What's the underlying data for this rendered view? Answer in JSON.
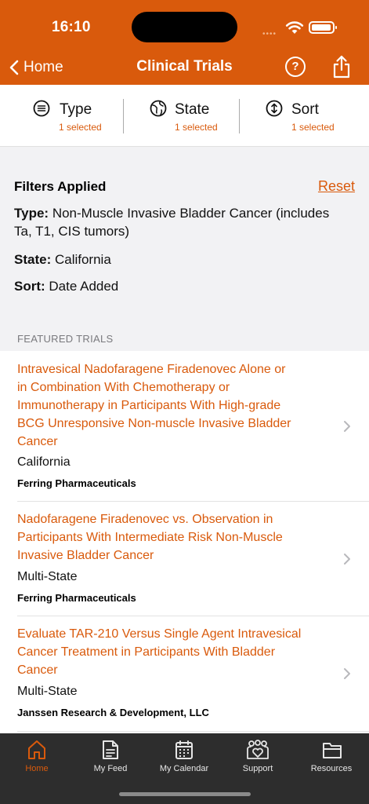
{
  "status_bar": {
    "time": "16:10"
  },
  "nav": {
    "back_label": "Home",
    "title": "Clinical Trials"
  },
  "filters": [
    {
      "label": "Type",
      "sub": "1 selected",
      "icon": "list-icon"
    },
    {
      "label": "State",
      "sub": "1 selected",
      "icon": "globe-icon"
    },
    {
      "label": "Sort",
      "sub": "1 selected",
      "icon": "sort-icon"
    }
  ],
  "applied": {
    "heading": "Filters Applied",
    "reset": "Reset",
    "type_key": "Type:",
    "type_line1": "Non-Muscle Invasive Bladder Cancer (includes",
    "type_line2": "Ta, T1, CIS tumors)",
    "state_key": "State:",
    "state_val": "California",
    "sort_key": "Sort:",
    "sort_val": "Date Added"
  },
  "section": {
    "featured": "FEATURED TRIALS"
  },
  "trials": [
    {
      "title_lines": [
        "Intravesical Nadofaragene Firadenovec Alone or",
        "in Combination With Chemotherapy or",
        "Immunotherapy in Participants With High-grade",
        "BCG Unresponsive Non-muscle Invasive Bladder",
        "Cancer"
      ],
      "state": "California",
      "sponsor": "Ferring Pharmaceuticals"
    },
    {
      "title_lines": [
        "Nadofaragene Firadenovec vs. Observation in",
        "Participants With Intermediate Risk Non-Muscle",
        "Invasive Bladder Cancer"
      ],
      "state": "Multi-State",
      "sponsor": "Ferring Pharmaceuticals"
    },
    {
      "title_lines": [
        "Evaluate TAR-210 Versus Single Agent Intravesical",
        "Cancer Treatment in Participants With Bladder",
        "Cancer"
      ],
      "state": "Multi-State",
      "sponsor": "Janssen Research & Development, LLC"
    }
  ],
  "tabs": [
    {
      "label": "Home",
      "icon": "home-icon"
    },
    {
      "label": "My Feed",
      "icon": "document-icon"
    },
    {
      "label": "My Calendar",
      "icon": "calendar-icon"
    },
    {
      "label": "Support",
      "icon": "people-heart-icon"
    },
    {
      "label": "Resources",
      "icon": "folder-icon"
    }
  ],
  "colors": {
    "accent": "#d95a0c",
    "tab_bar": "#2d2d2d",
    "background": "#f2f2f4"
  }
}
